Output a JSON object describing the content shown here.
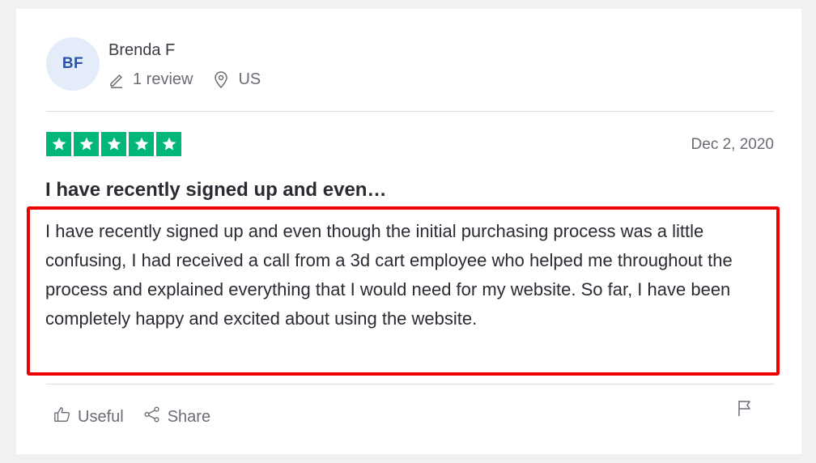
{
  "reviewer": {
    "initials": "BF",
    "name": "Brenda F",
    "review_count": "1 review",
    "country": "US"
  },
  "review": {
    "rating": 5,
    "date": "Dec 2, 2020",
    "title": "I have recently signed up and even…",
    "body": "I have recently signed up and even though the initial purchasing process was a little confusing, I had received a call from a 3d cart employee who helped me throughout the process and explained everything that I would need for my website. So far, I have been completely happy and excited about using the website."
  },
  "actions": {
    "useful_label": "Useful",
    "share_label": "Share"
  },
  "icons": {
    "pen": "pen-icon",
    "location": "location-pin-icon",
    "star": "star-icon",
    "thumbs_up": "thumbs-up-icon",
    "share": "share-icon",
    "flag": "flag-icon"
  },
  "colors": {
    "star_green": "#00b67a",
    "highlight_red": "#ee0000",
    "avatar_bg": "#e4ecf9",
    "avatar_text": "#2a53a6"
  }
}
